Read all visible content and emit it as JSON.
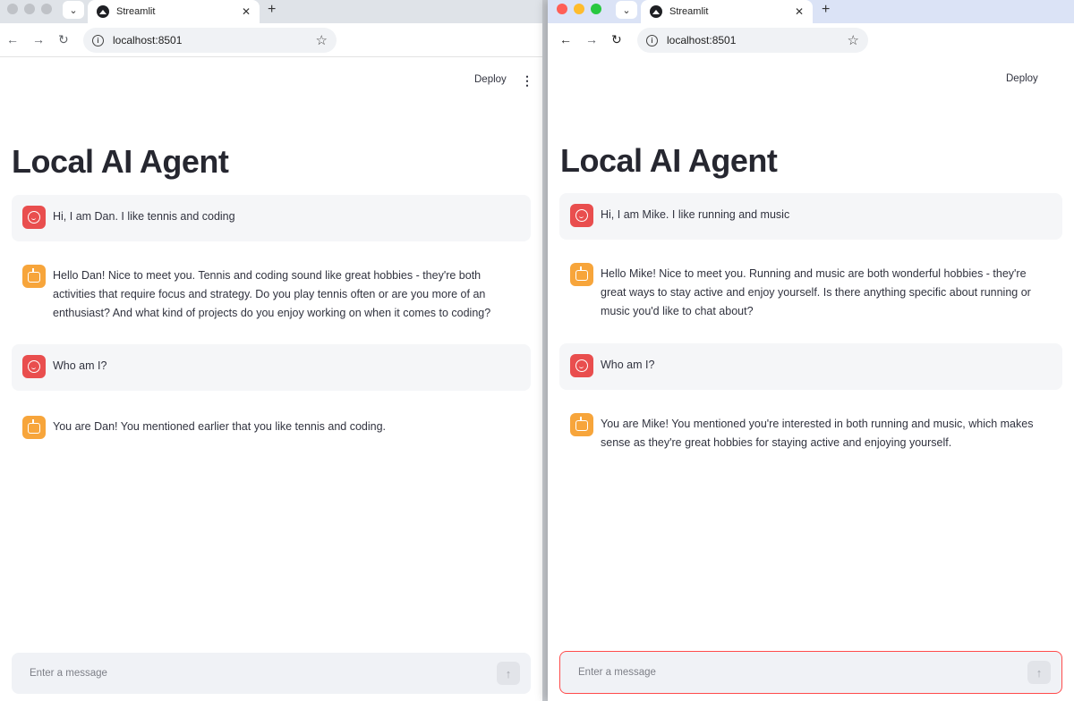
{
  "windows": [
    {
      "tab_title": "Streamlit",
      "url": "localhost:8501",
      "deploy_label": "Deploy",
      "app_title": "Local AI Agent",
      "messages": [
        {
          "role": "user",
          "text": "Hi, I am Dan. I like tennis and coding"
        },
        {
          "role": "assistant",
          "text": "Hello Dan! Nice to meet you. Tennis and coding sound like great hobbies - they're both activities that require focus and strategy. Do you play tennis often or are you more of an enthusiast? And what kind of projects do you enjoy working on when it comes to coding?"
        },
        {
          "role": "user",
          "text": "Who am I?"
        },
        {
          "role": "assistant",
          "text": "You are Dan! You mentioned earlier that you like tennis and coding."
        }
      ],
      "input_placeholder": "Enter a message"
    },
    {
      "tab_title": "Streamlit",
      "url": "localhost:8501",
      "deploy_label": "Deploy",
      "app_title": "Local AI Agent",
      "messages": [
        {
          "role": "user",
          "text": "Hi, I am Mike. I like running and music"
        },
        {
          "role": "assistant",
          "text": "Hello Mike! Nice to meet you. Running and music are both wonderful hobbies - they're great ways to stay active and enjoy yourself. Is there anything specific about running or music you'd like to chat about?"
        },
        {
          "role": "user",
          "text": "Who am I?"
        },
        {
          "role": "assistant",
          "text": "You are Mike! You mentioned you're interested in both running and music, which makes sense as they're great hobbies for staying active and enjoying yourself."
        }
      ],
      "input_placeholder": "Enter a message"
    }
  ],
  "icons": {
    "tab_menu": "chevron-down-icon",
    "favicon": "streamlit-crown-icon",
    "close": "close-icon",
    "new_tab": "plus-icon",
    "back": "arrow-left-icon",
    "forward": "arrow-right-icon",
    "reload": "reload-icon",
    "site_info": "info-icon",
    "bookmark": "star-icon",
    "menu": "kebab-icon",
    "user_avatar": "face-icon",
    "assistant_avatar": "robot-icon",
    "send": "arrow-up-icon"
  },
  "colors": {
    "user_avatar": "#e94e4e",
    "assistant_avatar": "#f7a53b",
    "focus_border": "#ff4b4b",
    "mac_close": "#ff5f57",
    "mac_min": "#febc2e",
    "mac_max": "#28c840"
  }
}
